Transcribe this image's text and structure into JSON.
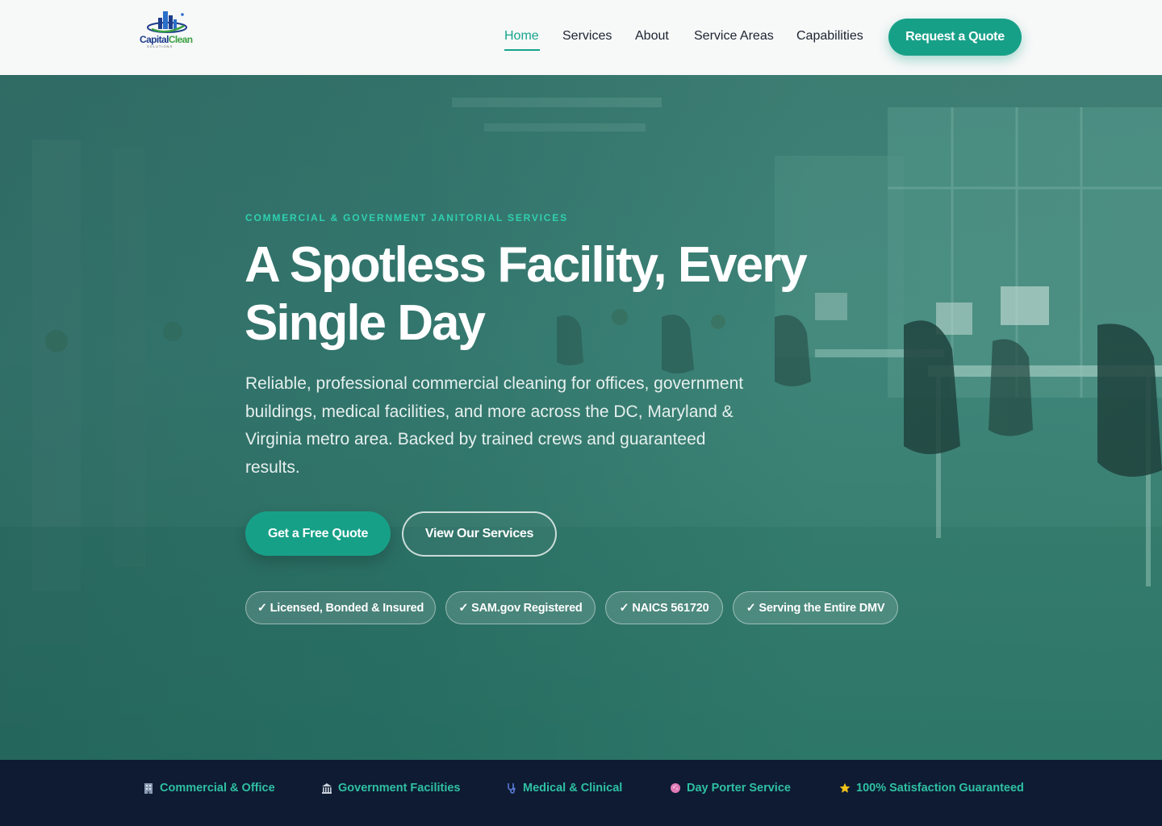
{
  "header": {
    "logo": {
      "word1": "Capital",
      "word2": "Clean",
      "sub": "SOLUTIONS"
    },
    "nav": [
      {
        "label": "Home",
        "active": true
      },
      {
        "label": "Services"
      },
      {
        "label": "About"
      },
      {
        "label": "Service Areas"
      },
      {
        "label": "Capabilities"
      }
    ],
    "cta_label": "Request a Quote"
  },
  "hero": {
    "eyebrow": "COMMERCIAL & GOVERNMENT JANITORIAL SERVICES",
    "headline_line1": "A Spotless Facility, Every",
    "headline_line2": "Single Day",
    "subhead": "Reliable, professional commercial cleaning for offices, government buildings, medical facilities, and more across the DC, Maryland & Virginia metro area. Backed by trained crews and guaranteed results.",
    "primary_button": "Get a Free Quote",
    "secondary_button": "View Our Services",
    "badges": [
      "✓ Licensed, Bonded & Insured",
      "✓ SAM.gov Registered",
      "✓ NAICS 561720",
      "✓ Serving the Entire DMV"
    ]
  },
  "strip": {
    "items": [
      {
        "icon": "office-building-icon",
        "label": "Commercial & Office"
      },
      {
        "icon": "government-building-icon",
        "label": "Government Facilities"
      },
      {
        "icon": "stethoscope-icon",
        "label": "Medical & Clinical"
      },
      {
        "icon": "cleaning-sponge-icon",
        "label": "Day Porter Service"
      },
      {
        "icon": "star-icon",
        "label": "100% Satisfaction Guaranteed"
      }
    ]
  },
  "colors": {
    "accent": "#17a088",
    "accent_text": "#2fd0b0",
    "navy": "#0e1b33",
    "logo_blue": "#1d3d8b",
    "logo_green": "#3aa041"
  }
}
